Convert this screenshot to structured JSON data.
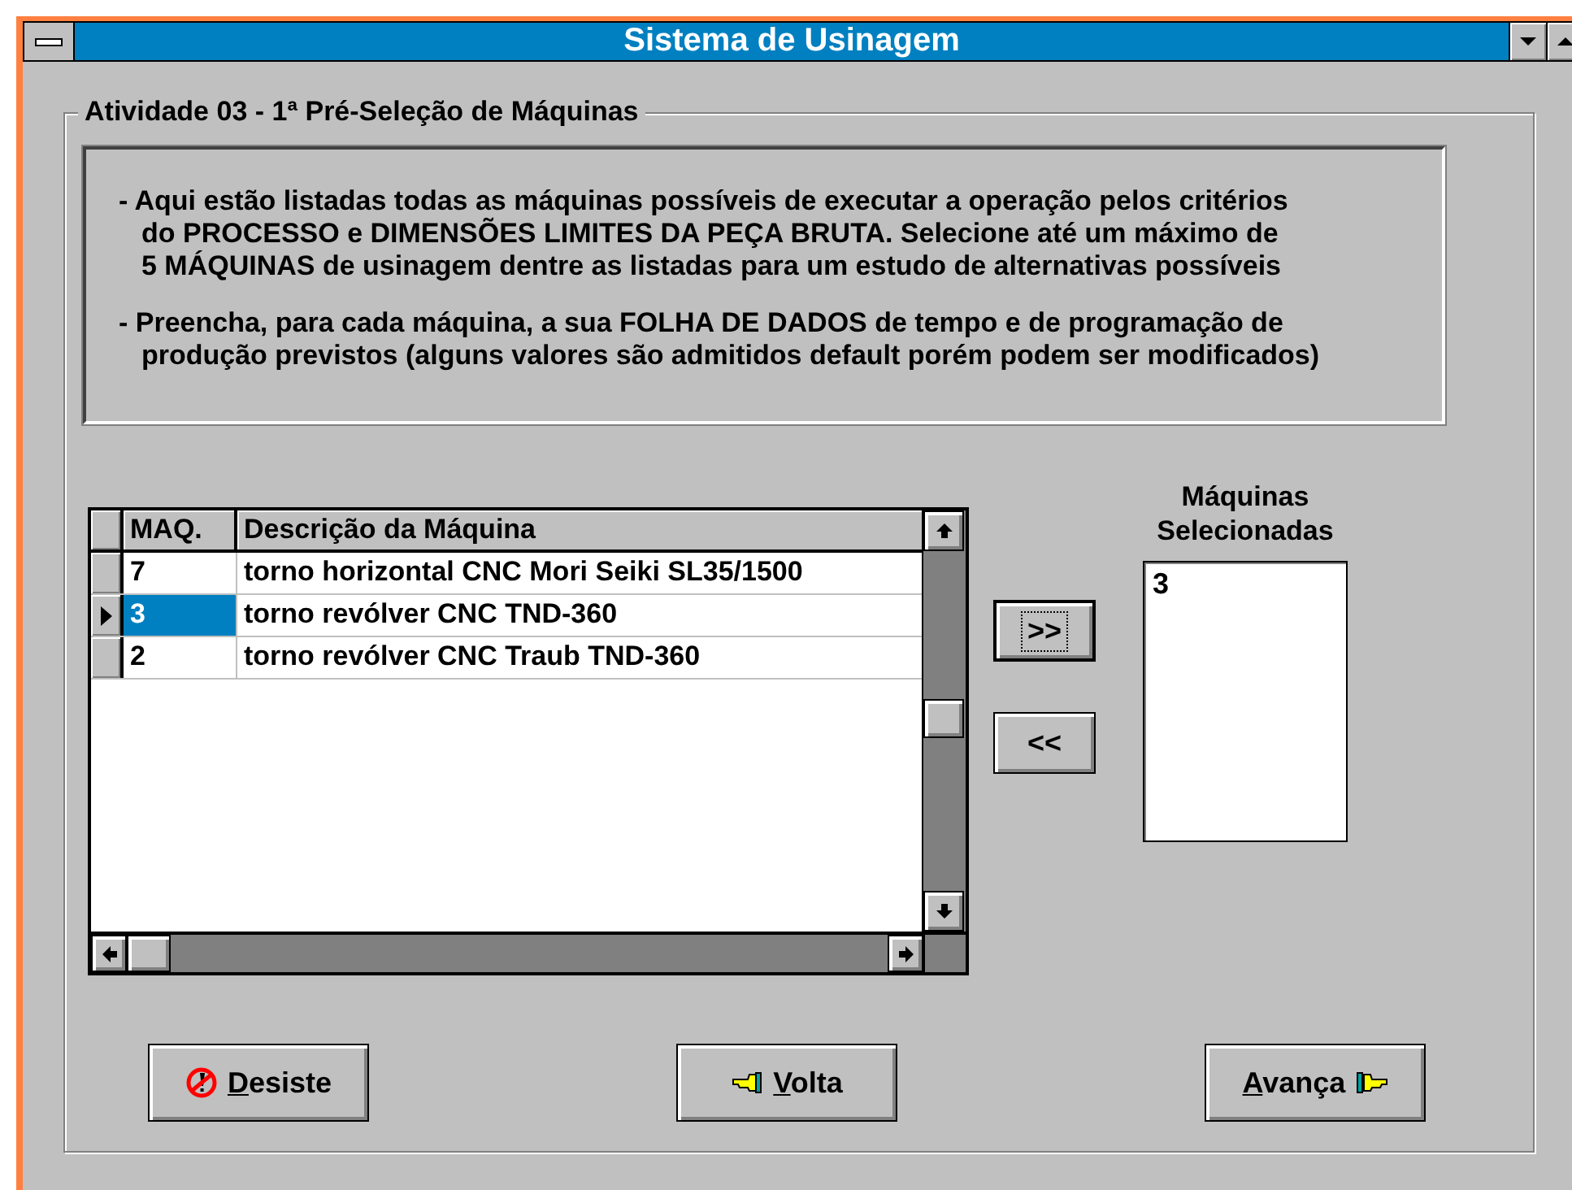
{
  "window": {
    "title": "Sistema de Usinagem"
  },
  "group": {
    "label": "Atividade 03 - 1ª Pré-Seleção de Máquinas"
  },
  "instructions": [
    "- Aqui estão listadas todas as máquinas possíveis de executar a operação pelos critérios\ndo PROCESSO e DIMENSÕES LIMITES DA PEÇA BRUTA. Selecione até um máximo de\n5 MÁQUINAS de usinagem dentre as listadas para um estudo de alternativas possíveis",
    "- Preencha, para cada máquina, a sua FOLHA DE DADOS de tempo e de programação de\nprodução previstos (alguns valores são admitidos default porém podem ser modificados)"
  ],
  "machine_grid": {
    "columns": [
      "MAQ.",
      "Descrição da Máquina"
    ],
    "rows": [
      {
        "cells": [
          "7",
          "torno horizontal CNC Mori Seiki SL35/1500"
        ],
        "selected": false
      },
      {
        "cells": [
          "3",
          "torno revólver CNC TND-360"
        ],
        "selected": true
      },
      {
        "cells": [
          "2",
          "torno revólver CNC Traub TND-360"
        ],
        "selected": false
      }
    ]
  },
  "transfer_buttons": [
    {
      "label": ">>",
      "focused": true
    },
    {
      "label": "<<",
      "focused": false
    }
  ],
  "selected_machines": {
    "label": "Máquinas Selecionadas",
    "items": [
      "3"
    ]
  },
  "buttons": [
    {
      "label": "Desiste",
      "kind": "cancel",
      "underline_first": true
    },
    {
      "label": "Volta",
      "kind": "back",
      "underline_first": true
    },
    {
      "label": "Avança",
      "kind": "next",
      "underline_first": true
    }
  ]
}
